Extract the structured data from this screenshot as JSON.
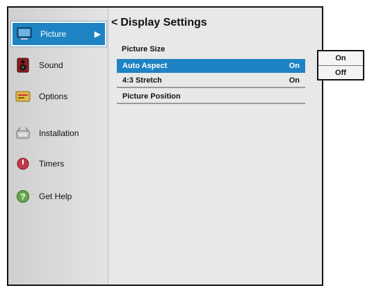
{
  "sidebar": {
    "items": [
      {
        "label": "Picture",
        "icon": "monitor-icon",
        "active": true
      },
      {
        "label": "Sound",
        "icon": "speaker-icon"
      },
      {
        "label": "Options",
        "icon": "options-icon"
      },
      {
        "label": "Installation",
        "icon": "installation-icon"
      },
      {
        "label": "Timers",
        "icon": "timer-icon"
      },
      {
        "label": "Get Help",
        "icon": "help-icon"
      }
    ],
    "active_arrow": "▶"
  },
  "main": {
    "back_glyph": "<",
    "title": "Display Settings",
    "section_label": "Picture Size",
    "rows": [
      {
        "label": "Auto Aspect",
        "value": "On",
        "selected": true
      },
      {
        "label": "4:3 Stretch",
        "value": "On"
      },
      {
        "label": "Picture Position",
        "value": ""
      }
    ]
  },
  "popup": {
    "options": [
      "On",
      "Off"
    ]
  },
  "colors": {
    "accent": "#1e83c3",
    "panel": "#e8e8e8",
    "sidebar": "#d8d8d8"
  }
}
